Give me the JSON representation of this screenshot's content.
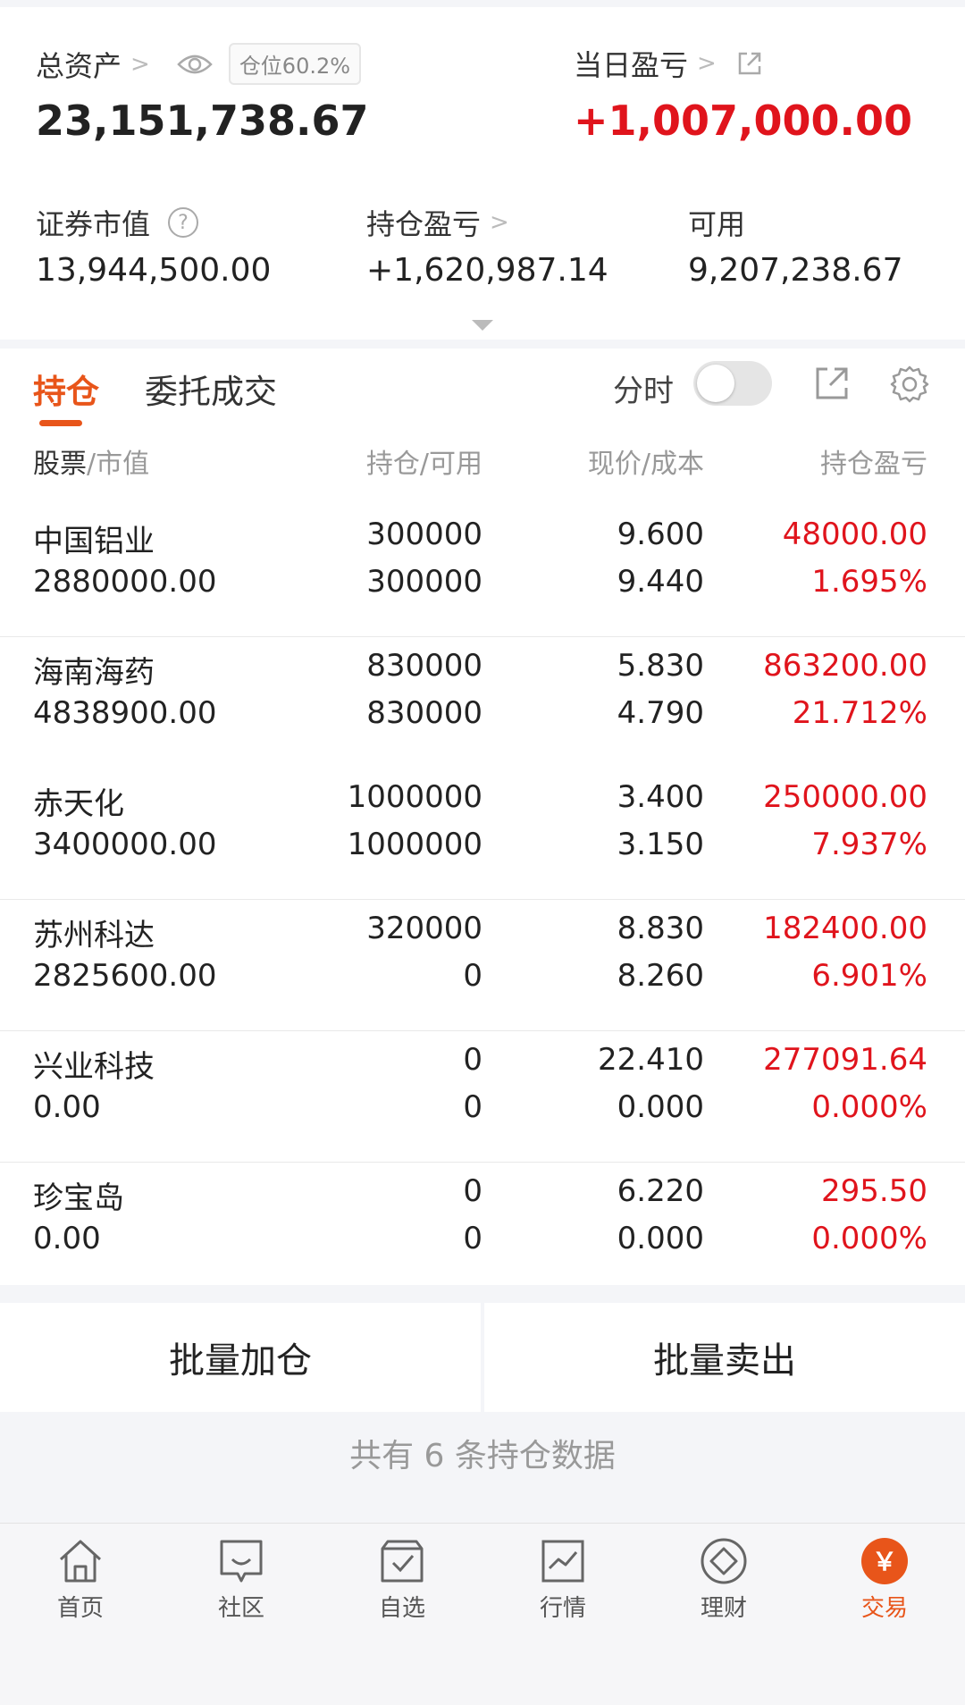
{
  "summary": {
    "total_assets_label": "总资产",
    "position_badge": "仓位60.2%",
    "total_assets_value": "23,151,738.67",
    "daily_pl_label": "当日盈亏",
    "daily_pl_value": "+1,007,000.00",
    "market_value_label": "证券市值",
    "market_value_value": "13,944,500.00",
    "holding_pl_label": "持仓盈亏",
    "holding_pl_value": "+1,620,987.14",
    "available_label": "可用",
    "available_value": "9,207,238.67",
    "help_glyph": "?"
  },
  "tabs": {
    "holdings": "持仓",
    "orders": "委托成交",
    "intraday_label": "分时"
  },
  "columns": {
    "stock_a": "股票",
    "stock_b": "/市值",
    "hold_a": "持仓",
    "hold_b": "/可用",
    "price_a": "现价",
    "price_b": "/成本",
    "pl": "持仓盈亏"
  },
  "rows": [
    {
      "name": "中国铝业",
      "value": "2880000.00",
      "hold": "300000",
      "avail": "300000",
      "price": "9.600",
      "cost": "9.440",
      "pl": "48000.00",
      "pl_pct": "1.695%"
    },
    {
      "name": "海南海药",
      "value": "4838900.00",
      "hold": "830000",
      "avail": "830000",
      "price": "5.830",
      "cost": "4.790",
      "pl": "863200.00",
      "pl_pct": "21.712%"
    },
    {
      "name": "赤天化",
      "value": "3400000.00",
      "hold": "1000000",
      "avail": "1000000",
      "price": "3.400",
      "cost": "3.150",
      "pl": "250000.00",
      "pl_pct": "7.937%"
    },
    {
      "name": "苏州科达",
      "value": "2825600.00",
      "hold": "320000",
      "avail": "0",
      "price": "8.830",
      "cost": "8.260",
      "pl": "182400.00",
      "pl_pct": "6.901%"
    },
    {
      "name": "兴业科技",
      "value": "0.00",
      "hold": "0",
      "avail": "0",
      "price": "22.410",
      "cost": "0.000",
      "pl": "277091.64",
      "pl_pct": "0.000%"
    },
    {
      "name": "珍宝岛",
      "value": "0.00",
      "hold": "0",
      "avail": "0",
      "price": "6.220",
      "cost": "0.000",
      "pl": "295.50",
      "pl_pct": "0.000%"
    }
  ],
  "batch": {
    "add": "批量加仓",
    "sell": "批量卖出"
  },
  "footer_note": "共有 6 条持仓数据",
  "nav": [
    {
      "label": "首页",
      "icon": "home-icon"
    },
    {
      "label": "社区",
      "icon": "community-icon"
    },
    {
      "label": "自选",
      "icon": "watchlist-icon"
    },
    {
      "label": "行情",
      "icon": "market-icon"
    },
    {
      "label": "理财",
      "icon": "wealth-icon"
    },
    {
      "label": "交易",
      "icon": "trade-icon",
      "glyph": "￥"
    }
  ],
  "colors": {
    "accent": "#e8551a",
    "up": "#e0141c"
  }
}
